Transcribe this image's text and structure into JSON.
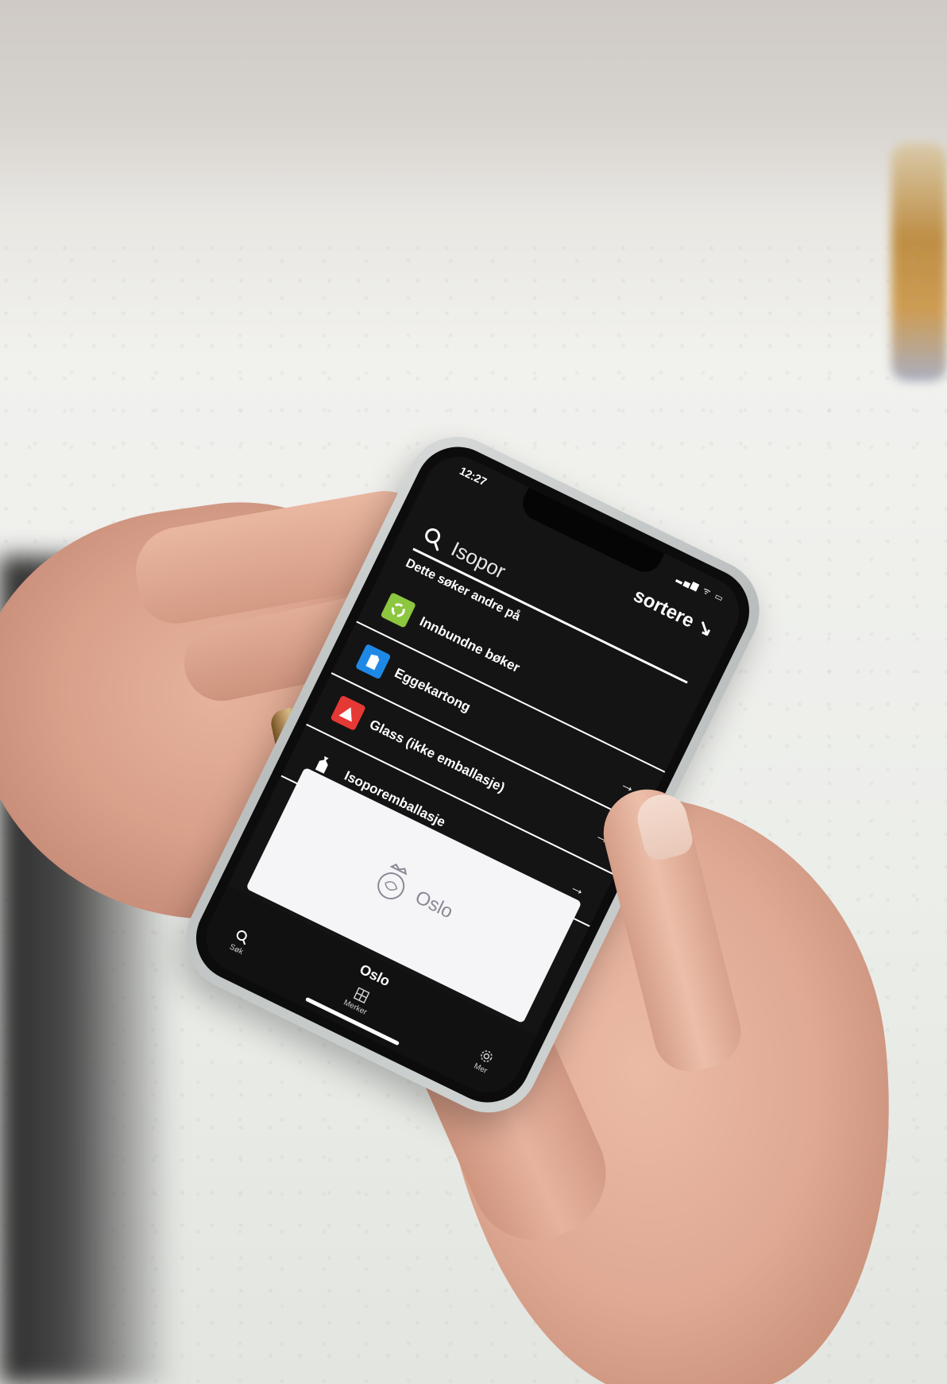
{
  "status_bar": {
    "time": "12:27",
    "icons": "▂▄▆ ᯤ ▭"
  },
  "app": {
    "brand": "sortere ↘"
  },
  "search": {
    "value": "Isopor"
  },
  "section": {
    "title": "Dette søker andre på"
  },
  "results": [
    {
      "label": "Innbundne bøker",
      "badge_color": "#8dc63f",
      "icon": "recycle-icon"
    },
    {
      "label": "Eggekartong",
      "badge_color": "#1e88e5",
      "icon": "carton-icon"
    },
    {
      "label": "Glass (ikke emballasje)",
      "badge_color": "#e53935",
      "icon": "warning-triangle-icon"
    },
    {
      "label": "Isoporemballasje",
      "badge_color": "#141414",
      "icon": "bag-icon"
    }
  ],
  "arrow_glyph": "→",
  "overlay": {
    "name": "Oslo"
  },
  "bottom_nav": {
    "city": "Oslo",
    "search_label": "Søk",
    "markers_label": "Merker",
    "more_label": "Mer"
  }
}
